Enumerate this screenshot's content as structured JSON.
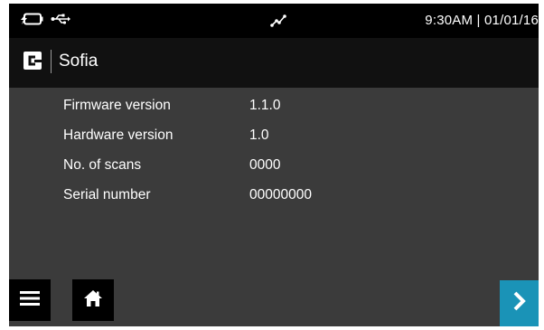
{
  "status_bar": {
    "time_date": "9:30AM | 01/01/16",
    "icons": [
      "battery-charging-icon",
      "usb-icon",
      "signal-icon"
    ]
  },
  "brand": {
    "logo_icon": "brand-logo-icon",
    "name": "Sofia"
  },
  "device_info": [
    {
      "label": "Firmware version",
      "value": "1.1.0"
    },
    {
      "label": "Hardware version",
      "value": "1.0"
    },
    {
      "label": "No. of scans",
      "value": "0000"
    },
    {
      "label": "Serial number",
      "value": "00000000"
    }
  ],
  "footer": {
    "menu_icon": "menu-icon",
    "home_icon": "home-icon",
    "next_icon": "chevron-right-icon"
  },
  "colors": {
    "background": "#3b3b3b",
    "status_bar": "#000000",
    "brand_bar": "#111111",
    "accent": "#1a93b7",
    "text": "#ffffff"
  }
}
